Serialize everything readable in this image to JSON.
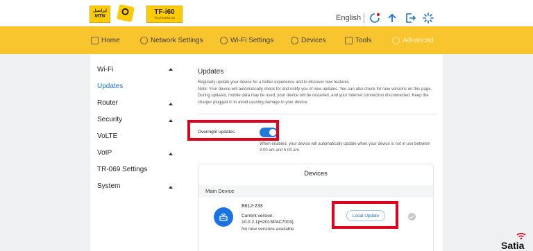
{
  "header": {
    "logo_mtn_fa": "ایرانسل",
    "logo_mtn_en": "MTN",
    "logo_tf_model": "TF-i60",
    "logo_tf_bands": "TD-LTE/4G/4.5G",
    "language": "English"
  },
  "nav": {
    "items": [
      {
        "label": "Home"
      },
      {
        "label": "Network Settings"
      },
      {
        "label": "Wi-Fi Settings"
      },
      {
        "label": "Devices"
      },
      {
        "label": "Tools"
      },
      {
        "label": "Advanced"
      }
    ],
    "active": "Advanced"
  },
  "sidebar": {
    "items": [
      {
        "label": "Wi-Fi"
      },
      {
        "label": "Updates"
      },
      {
        "label": "Router"
      },
      {
        "label": "Security"
      },
      {
        "label": "VoLTE"
      },
      {
        "label": "VoIP"
      },
      {
        "label": "TR-069 Settings"
      },
      {
        "label": "System"
      }
    ],
    "active": "Updates"
  },
  "main": {
    "title": "Updates",
    "desc1": "Regularly update your device for a better experience and to discover new features.",
    "desc2": "Note: Your device will automatically check for and notify you of new updates. You can also check for new versions on this page. During updates, mobile data may be used, your device will be restarted, and your Internet connection disconnected. Keep the charger plugged in to avoid causing damage to your device.",
    "overnight_label": "Overnight updates",
    "overnight_on": true,
    "overnight_desc": "When enabled, your device will automatically update when your device is not in use between 3:00 am and 5:00 am.",
    "devices_title": "Devices",
    "main_device_label": "Main Device",
    "device_name": "B612-233",
    "current_version_label": "Current version:",
    "current_version": "10.0.2.1(H201SP4C7003)",
    "no_new": "No new versions available",
    "local_update": "Local Update"
  },
  "watermark": "Satia",
  "colors": {
    "accent_yellow": "#f9c52f",
    "link_blue": "#1a73c8",
    "toggle_blue": "#2279d6",
    "highlight_red": "#e0001b"
  }
}
